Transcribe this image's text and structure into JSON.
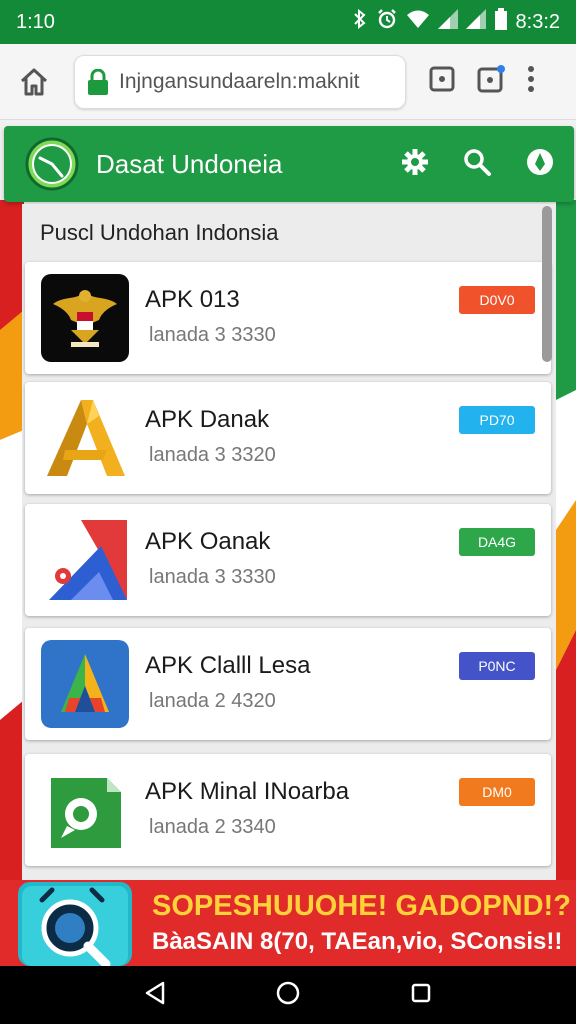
{
  "status": {
    "time": "1:10",
    "clock": "8:3:2"
  },
  "browser": {
    "url": "Injngansundaareln:maknit"
  },
  "app": {
    "title": "Dasat Undoneia"
  },
  "section": {
    "title": "Puscl Undohan Indonsia"
  },
  "apps": [
    {
      "name": "APK 013",
      "sub": "lanada 3 3330",
      "badge": "D0V0",
      "badge_color": "#f0532b",
      "icon": "garuda-icon"
    },
    {
      "name": "APK Danak",
      "sub": "lanada 3 3320",
      "badge": "PD70",
      "badge_color": "#22b3ee",
      "icon": "gold-a-icon"
    },
    {
      "name": "APK Oanak",
      "sub": "lanada 3 3330",
      "badge": "DA4G",
      "badge_color": "#2ea64a",
      "icon": "red-blue-tri-icon"
    },
    {
      "name": "APK Clalll Lesa",
      "sub": "lanada 2 4320",
      "badge": "P0NC",
      "badge_color": "#4453c8",
      "icon": "blue-a-icon"
    },
    {
      "name": "APK Minal INoarba",
      "sub": "lanada 2 3340",
      "badge": "DM0",
      "badge_color": "#f27a1e",
      "icon": "green-chat-icon"
    }
  ],
  "banner": {
    "line1": "SOPESHUUOHE! GADOPND!?",
    "line2": "BàaSAIN 8(70, TAEan,vio, SConsis!!"
  },
  "colors": {
    "primary": "#1f9a45",
    "status": "#138a38",
    "banner": "#e12b2b"
  }
}
